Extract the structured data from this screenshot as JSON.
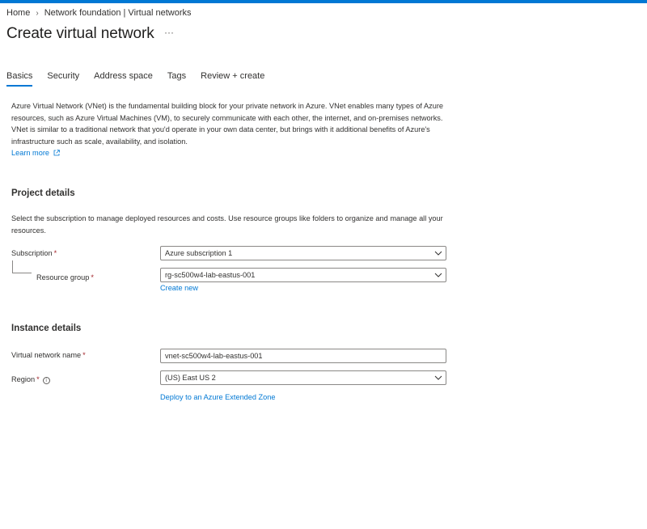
{
  "breadcrumb": {
    "home": "Home",
    "parent": "Network foundation | Virtual networks"
  },
  "page": {
    "title": "Create virtual network",
    "more": "···"
  },
  "tabs": [
    {
      "label": "Basics",
      "active": true
    },
    {
      "label": "Security",
      "active": false
    },
    {
      "label": "Address space",
      "active": false
    },
    {
      "label": "Tags",
      "active": false
    },
    {
      "label": "Review + create",
      "active": false
    }
  ],
  "intro": {
    "text": "Azure Virtual Network (VNet) is the fundamental building block for your private network in Azure. VNet enables many types of Azure resources, such as Azure Virtual Machines (VM), to securely communicate with each other, the internet, and on-premises networks. VNet is similar to a traditional network that you'd operate in your own data center, but brings with it additional benefits of Azure's infrastructure such as scale, availability, and isolation.",
    "learn_more": "Learn more"
  },
  "project": {
    "heading": "Project details",
    "description": "Select the subscription to manage deployed resources and costs. Use resource groups like folders to organize and manage all your resources.",
    "subscription_label": "Subscription",
    "subscription_value": "Azure subscription 1",
    "resource_group_label": "Resource group",
    "resource_group_value": "rg-sc500w4-lab-eastus-001",
    "create_new": "Create new"
  },
  "instance": {
    "heading": "Instance details",
    "vnet_name_label": "Virtual network name",
    "vnet_name_value": "vnet-sc500w4-lab-eastus-001",
    "region_label": "Region",
    "region_value": "(US) East US 2",
    "extended_zone_link": "Deploy to an Azure Extended Zone"
  },
  "required_mark": "*",
  "colors": {
    "accent": "#0078d4",
    "required": "#a4262c",
    "text": "#323130",
    "border": "#8a8886"
  }
}
